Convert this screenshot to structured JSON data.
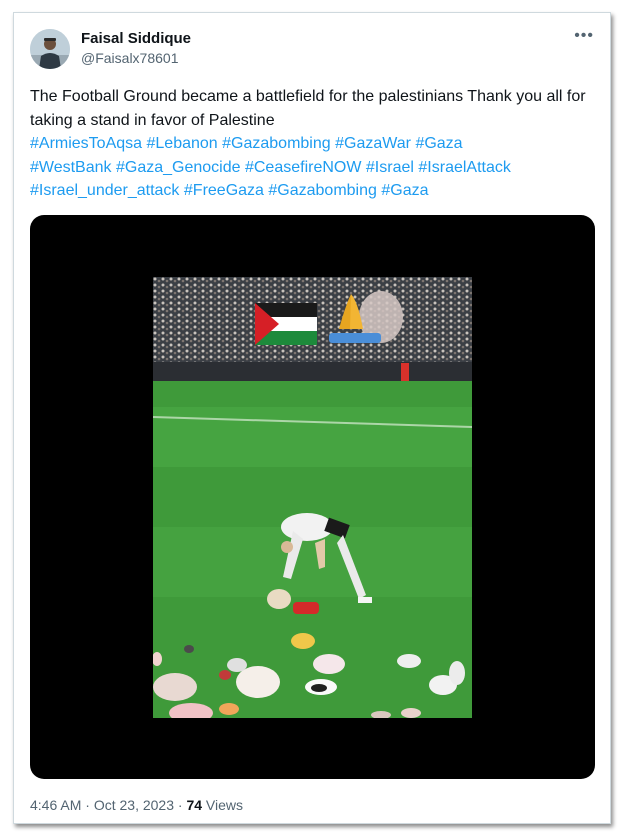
{
  "author": {
    "name": "Faisal Siddique",
    "handle": "@Faisalx78601"
  },
  "more_icon": "more-horizontal-icon",
  "tweet": {
    "text": "The Football Ground became a battlefield for the palestinians Thank you all for taking a stand in favor of Palestine",
    "hashtags": [
      "#ArmiesToAqsa",
      "#Lebanon",
      "#Gazabombing",
      "#GazaWar",
      "#Gaza",
      "#WestBank",
      "#Gaza_Genocide",
      "#CeasefireNOW",
      "#Israel",
      "#IsraelAttack",
      "#Israel_under_attack",
      "#FreeGaza",
      "#Gazabombing",
      "#Gaza"
    ]
  },
  "media": {
    "type": "video",
    "overlay_icons": [
      "palestine-flag-icon",
      "praying-hands-icon"
    ]
  },
  "meta": {
    "time": "4:46 AM",
    "date": "Oct 23, 2023",
    "views_count": "74",
    "views_label": "Views"
  },
  "colors": {
    "link": "#1d9bf0",
    "text": "#0f1419",
    "secondary": "#536471",
    "border": "#cfd9de"
  }
}
